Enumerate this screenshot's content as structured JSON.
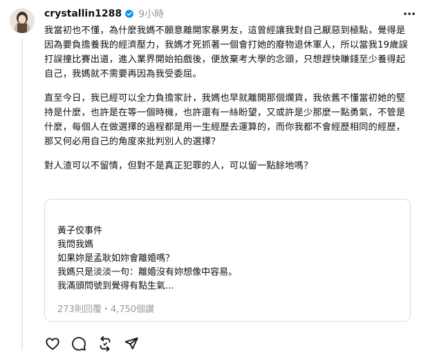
{
  "post": {
    "username": "crystallin1288",
    "verified_icon": "verified-badge-icon",
    "timestamp": "9小時",
    "paragraphs": [
      "我當初也不懂，為什麼我媽不願意離開家暴男友，這曾經讓我對自己厭惡到極點，覺得是因為要負擔養我的經濟壓力，我媽才死抓著一個會打她的廢物退休軍人，所以當我19歲誤打誤撞比賽出道，進入業界開始拍戲後，便放棄考大學的念頭，只想趕快賺錢至少養得起自己，我媽就不需要再因為我受委屈。",
      "直至今日，我已經可以全力負擔家計，我媽也早就離開那個爛貨，我依舊不懂當初她的堅持是什麼，也許是在等一個時機，也許還有一絲盼望，又或許是少那麼一點勇氣，不管是什麼，每個人在做選擇的過程都是用一生經歷去運算的，而你我都不會經歷相同的經歷，那又何必用自己的角度來批判別人的選擇？",
      "對人渣可以不留情，但對不是真正犯罪的人，可以留一點餘地嗎？"
    ]
  },
  "quote": {
    "lines": [
      "黃子佼事件",
      "我問我媽",
      "如果妳是孟耿如妳會離婚嗎？",
      "我媽只是淡淡一句：離婚沒有妳想像中容易。",
      "我滿頭問號到覺得有點生氣..."
    ],
    "stats": "273則回覆・4,750個讚"
  },
  "actions": {
    "like": "heart-icon",
    "reply": "comment-icon",
    "repost": "repost-icon",
    "share": "share-icon"
  }
}
